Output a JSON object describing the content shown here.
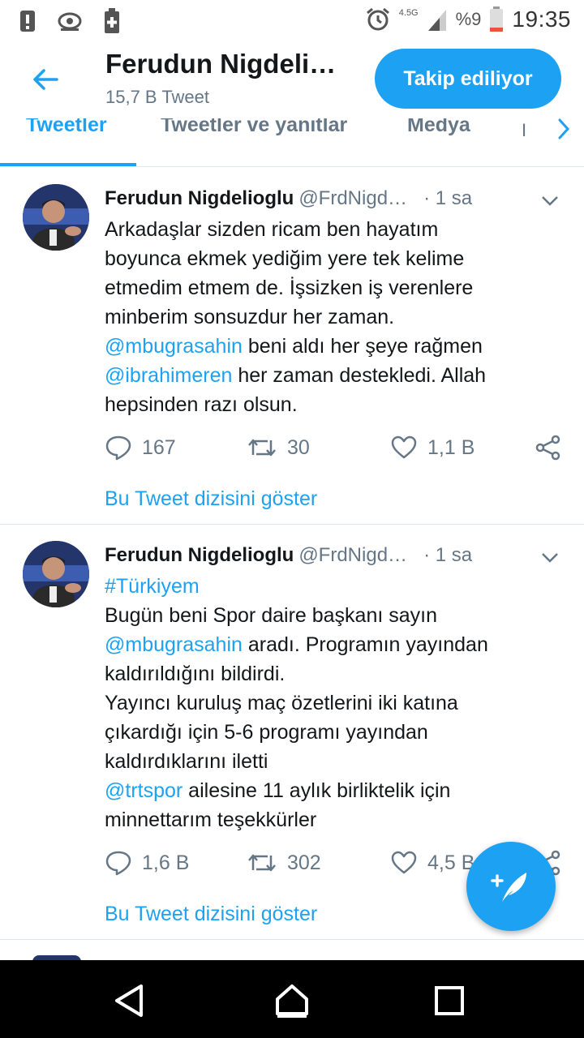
{
  "status_bar": {
    "time": "19:35",
    "battery_pct": "%9",
    "network": "4.5G",
    "icons": [
      "alert-icon",
      "sync-icon",
      "battery-plus-icon",
      "alarm-icon",
      "signal-icon",
      "battery-icon"
    ]
  },
  "header": {
    "title": "Ferudun Nigdeli…",
    "subtitle": "15,7 B Tweet",
    "follow_label": "Takip ediliyor"
  },
  "tabs": [
    {
      "label": "Tweetler",
      "active": true
    },
    {
      "label": "Tweetler ve yanıtlar",
      "active": false
    },
    {
      "label": "Medya",
      "active": false
    },
    {
      "label": "I",
      "active": false
    }
  ],
  "tweets": [
    {
      "name": "Ferudun Nigdelioglu",
      "handle": "@FrdNigd…",
      "time": "· 1 sa",
      "body": [
        [
          {
            "t": "Arkadaşlar sizden ricam ben hayatım"
          }
        ],
        [
          {
            "t": "boyunca ekmek yediğim yere tek kelime"
          }
        ],
        [
          {
            "t": "etmedim etmem de. İşsizken iş verenlere"
          }
        ],
        [
          {
            "t": "minberim sonsuzdur her zaman."
          }
        ],
        [
          {
            "t": "@mbugrasahin",
            "link": true
          },
          {
            "t": " beni aldı her şeye rağmen"
          }
        ],
        [
          {
            "t": "@ibrahimeren",
            "link": true
          },
          {
            "t": " her zaman destekledi. Allah"
          }
        ],
        [
          {
            "t": "hepsinden razı olsun."
          }
        ]
      ],
      "replies": "167",
      "retweets": "30",
      "likes": "1,1 B",
      "thread_link": "Bu Tweet dizisini göster"
    },
    {
      "name": "Ferudun Nigdelioglu",
      "handle": "@FrdNigd…",
      "time": "· 1 sa",
      "body": [
        [
          {
            "t": "#Türkiyem",
            "link": true
          }
        ],
        [
          {
            "t": "Bugün beni Spor daire başkanı sayın"
          }
        ],
        [
          {
            "t": "@mbugrasahin",
            "link": true
          },
          {
            "t": " aradı. Programın yayından"
          }
        ],
        [
          {
            "t": "kaldırıldığını bildirdi."
          }
        ],
        [
          {
            "t": "Yayıncı kuruluş maç özetlerini iki katına"
          }
        ],
        [
          {
            "t": "çıkardığı için 5-6 programı yayından"
          }
        ],
        [
          {
            "t": "kaldırdıklarını iletti"
          }
        ],
        [
          {
            "t": "@trtspor",
            "link": true
          },
          {
            "t": " ailesine 11 aylık birliktelik için"
          }
        ],
        [
          {
            "t": "minnettarım teşekkürler"
          }
        ]
      ],
      "replies": "1,6 B",
      "retweets": "302",
      "likes": "4,5 B",
      "thread_link": "Bu Tweet dizisini göster"
    }
  ],
  "fab": {
    "icon": "compose-tweet-icon"
  },
  "nav": {
    "icons": [
      "back-triangle-icon",
      "home-icon",
      "recents-square-icon"
    ]
  },
  "colors": {
    "accent": "#1da1f2",
    "text": "#14171a",
    "secondary": "#657786",
    "divider": "#e1e8ed"
  }
}
